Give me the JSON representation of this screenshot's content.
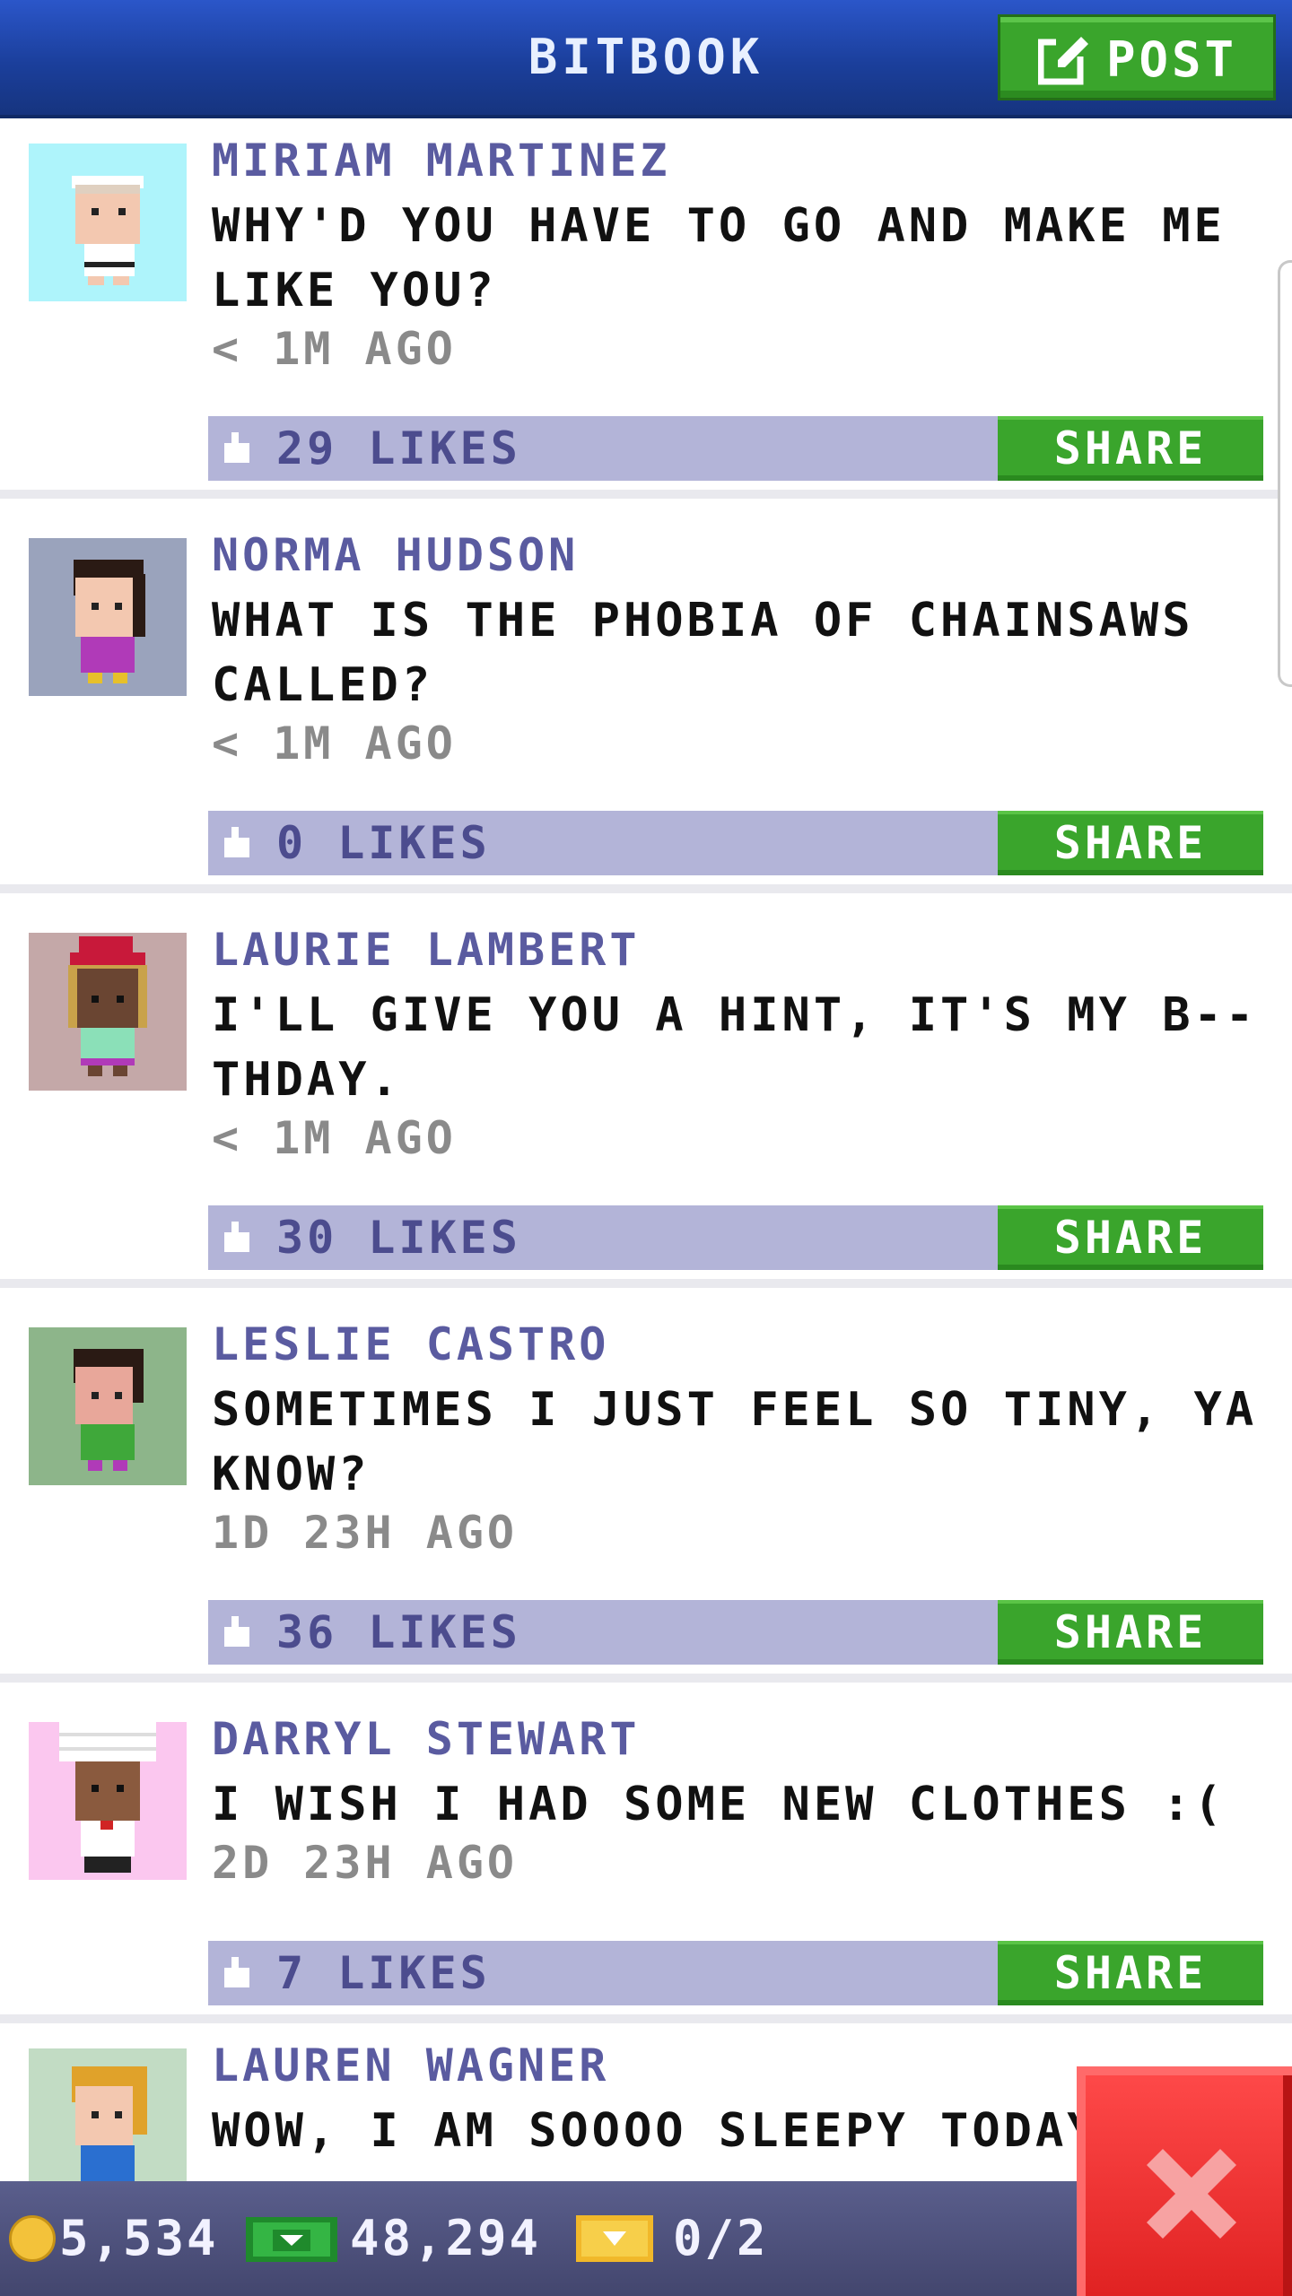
{
  "header": {
    "title": "BITBOOK",
    "post_label": "POST"
  },
  "posts": [
    {
      "author": "MIRIAM MARTINEZ",
      "message": "WHY'D YOU HAVE TO GO AND MAKE ME LIKE YOU?",
      "time": "< 1M AGO",
      "likes": "29 LIKES",
      "share": "SHARE",
      "avatar_bg": "#aef4fb"
    },
    {
      "author": "NORMA HUDSON",
      "message": "WHAT IS THE PHOBIA OF CHAINSAWS CALLED?",
      "time": "< 1M AGO",
      "likes": "0 LIKES",
      "share": "SHARE",
      "avatar_bg": "#9aa3bc"
    },
    {
      "author": "LAURIE LAMBERT",
      "message": "I'LL GIVE YOU A HINT, IT'S MY B--THDAY.",
      "time": "< 1M AGO",
      "likes": "30 LIKES",
      "share": "SHARE",
      "avatar_bg": "#c4a8a8"
    },
    {
      "author": "LESLIE CASTRO",
      "message": "SOMETIMES I JUST FEEL SO TINY, YA KNOW?",
      "time": "1D 23H AGO",
      "likes": "36 LIKES",
      "share": "SHARE",
      "avatar_bg": "#8db58a"
    },
    {
      "author": "DARRYL STEWART",
      "message": "I WISH I HAD SOME NEW CLOTHES :(",
      "time": "2D 23H AGO",
      "likes": "7 LIKES",
      "share": "SHARE",
      "avatar_bg": "#fbc7ef"
    },
    {
      "author": "LAUREN WAGNER",
      "message": "WOW, I AM SOOOO SLEEPY TODAY",
      "time": "",
      "likes": "",
      "share": "",
      "avatar_bg": "#c2dcc4"
    }
  ],
  "bottom_bar": {
    "coins": "5,534",
    "bux": "48,294",
    "tickets": "0/2"
  },
  "icons": {
    "post": "edit-icon",
    "like": "thumbs-up-icon",
    "coin": "coin-icon",
    "bux": "bux-icon",
    "ticket": "ticket-icon",
    "close": "close-icon"
  },
  "colors": {
    "header": "#1f47ad",
    "accent_green": "#3aa52c",
    "likes_bar": "#b3b4d8",
    "author": "#5a5ba0",
    "close": "#e93030"
  }
}
